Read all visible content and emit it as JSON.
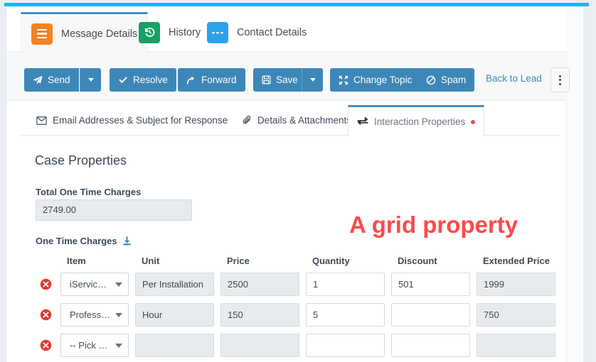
{
  "theme": {
    "accent_cyan": "#00bcf2",
    "primary_blue": "#3d87b8",
    "tab_orange": "#f5821f",
    "tab_green": "#16a163",
    "tab_blue": "#2aa3ef",
    "annotation_red": "#fb4a4a",
    "delete_red": "#e03a32",
    "readonly_gray": "#e7ebee"
  },
  "nav_tabs": [
    {
      "label": "Message Details",
      "icon": "hamburger-icon",
      "color": "#f5821f",
      "active": true
    },
    {
      "label": "History",
      "icon": "history-clock-icon",
      "color": "#16a163",
      "active": false
    },
    {
      "label": "Contact Details",
      "icon": "dashes-icon",
      "color": "#2aa3ef",
      "active": false
    }
  ],
  "toolbar": {
    "send_label": "Send",
    "resolve_label": "Resolve",
    "forward_label": "Forward",
    "save_label": "Save",
    "change_topic_label": "Change Topic",
    "spam_label": "Spam",
    "back_to_lead_label": "Back to Lead"
  },
  "sub_tabs": [
    {
      "label": "Email Addresses & Subject for Response",
      "icon": "envelope-icon",
      "active": false,
      "has_dot": false
    },
    {
      "label": "Details & Attachments",
      "icon": "paperclip-icon",
      "active": false,
      "has_dot": false
    },
    {
      "label": "Interaction Properties",
      "icon": "exchange-arrows-icon",
      "active": true,
      "has_dot": true
    }
  ],
  "main": {
    "section_title": "Case Properties",
    "total_label": "Total One Time Charges",
    "total_value": "2749.00",
    "grid_label": "One Time Charges",
    "grid_download_icon": "download-icon",
    "annotation": "A grid property"
  },
  "grid": {
    "columns": [
      "Item",
      "Unit",
      "Price",
      "Quantity",
      "Discount",
      "Extended Price"
    ],
    "rows": [
      {
        "item": "iServic…",
        "unit": "Per Installation",
        "price": "2500",
        "quantity": "1",
        "discount": "501",
        "extended_price": "1999"
      },
      {
        "item": "Profess…",
        "unit": "Hour",
        "price": "150",
        "quantity": "5",
        "discount": "",
        "extended_price": "750"
      },
      {
        "item": "-- Pick …",
        "unit": "",
        "price": "",
        "quantity": "",
        "discount": "",
        "extended_price": ""
      }
    ]
  }
}
